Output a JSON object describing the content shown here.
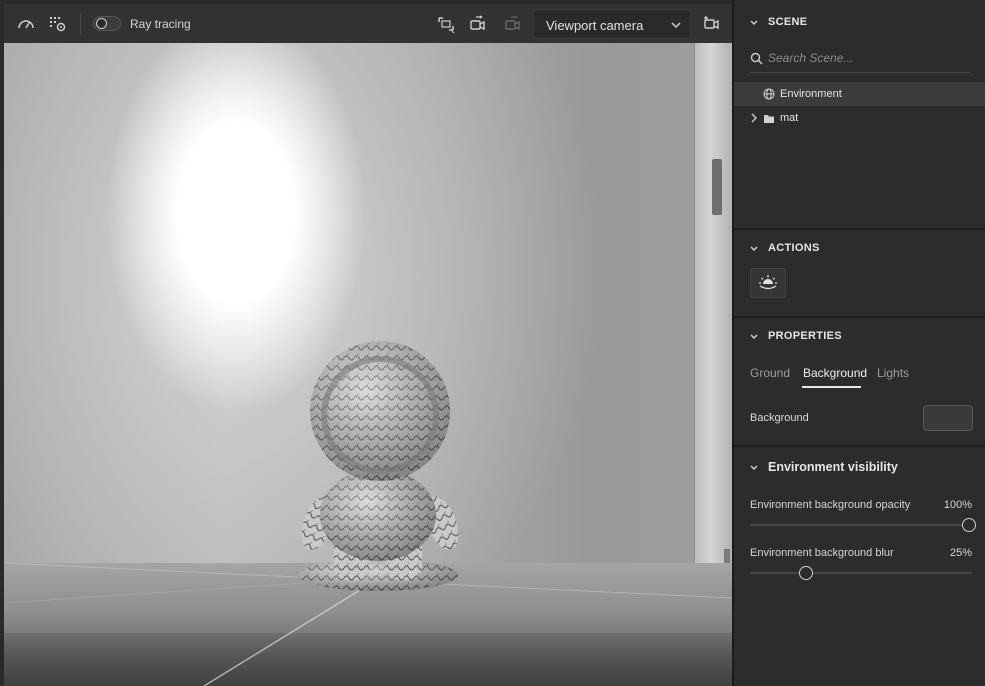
{
  "toolbar": {
    "raytracing_label": "Ray tracing",
    "raytracing_enabled": false,
    "camera_select": {
      "value": "Viewport camera"
    },
    "icons": [
      "speedometer-icon",
      "render-settings-icon",
      "frame-select-icon",
      "camera-export-icon",
      "camera-disabled-icon",
      "add-camera-icon"
    ]
  },
  "scene": {
    "title": "SCENE",
    "search_placeholder": "Search Scene...",
    "tree": [
      {
        "label": "Environment",
        "icon": "globe-icon",
        "selected": true
      },
      {
        "label": "mat",
        "icon": "folder-icon",
        "selected": false
      }
    ]
  },
  "actions": {
    "title": "ACTIONS",
    "buttons": [
      {
        "icon": "sun-horizon-icon"
      }
    ]
  },
  "properties": {
    "title": "PROPERTIES",
    "tabs": [
      {
        "label": "Ground",
        "active": false
      },
      {
        "label": "Background",
        "active": true
      },
      {
        "label": "Lights",
        "active": false
      }
    ],
    "background_label": "Background",
    "background_color": "#3a3a3a",
    "env_visibility": {
      "title": "Environment visibility",
      "sliders": [
        {
          "label": "Environment background opacity",
          "value_text": "100%",
          "value": 1.0
        },
        {
          "label": "Environment background blur",
          "value_text": "25%",
          "value": 0.25
        }
      ]
    }
  },
  "colors": {
    "panel_bg": "#2c2c2c",
    "toolbar_bg": "#323232",
    "selected_row": "#3c3c3c",
    "text": "#d8d8d8"
  }
}
